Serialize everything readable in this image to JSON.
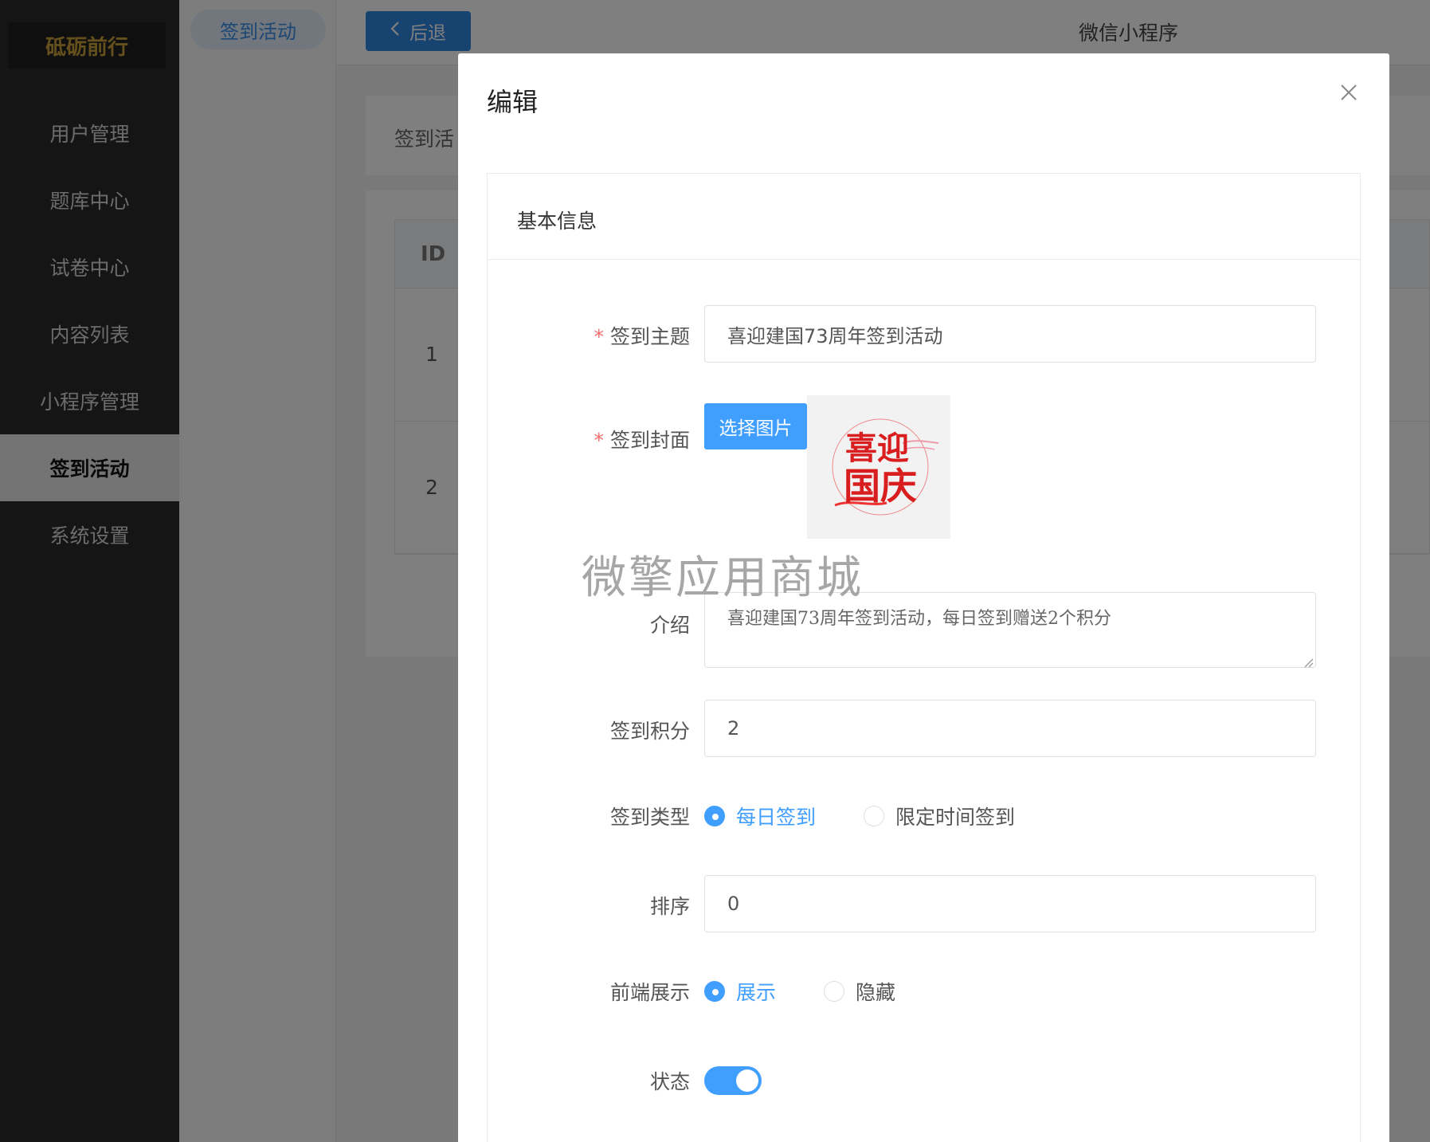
{
  "sidebar": {
    "logo": "砥砺前行",
    "items": [
      {
        "label": "用户管理"
      },
      {
        "label": "题库中心"
      },
      {
        "label": "试卷中心"
      },
      {
        "label": "内容列表"
      },
      {
        "label": "小程序管理"
      },
      {
        "label": "签到活动",
        "active": true
      },
      {
        "label": "系统设置"
      }
    ]
  },
  "subnav": {
    "label": "签到活动"
  },
  "header": {
    "back_label": "后退",
    "title": "微信小程序"
  },
  "background": {
    "crumb": "签到活",
    "table": {
      "id_header": "ID",
      "rows": [
        "1",
        "2"
      ]
    }
  },
  "dialog": {
    "title": "编辑",
    "section_title": "基本信息",
    "fields": {
      "theme": {
        "label": "签到主题",
        "required": true,
        "value": "喜迎建国73周年签到活动"
      },
      "cover": {
        "label": "签到封面",
        "required": true,
        "button": "选择图片",
        "image_text": [
          "喜迎",
          "国庆"
        ]
      },
      "intro": {
        "label": "介绍",
        "value": "喜迎建国73周年签到活动，每日签到赠送2个积分"
      },
      "points": {
        "label": "签到积分",
        "value": "2"
      },
      "type": {
        "label": "签到类型",
        "options": [
          "每日签到",
          "限定时间签到"
        ],
        "selected": "每日签到"
      },
      "sort": {
        "label": "排序",
        "value": "0"
      },
      "display": {
        "label": "前端展示",
        "options": [
          "展示",
          "隐藏"
        ],
        "selected": "展示"
      },
      "status": {
        "label": "状态",
        "on": true
      }
    }
  },
  "watermark": "微擎应用商城",
  "colors": {
    "primary": "#409eff",
    "sidebar_bg": "#2b2b2b",
    "logo_gold": "#c9a13b",
    "required": "#f56c6c"
  }
}
